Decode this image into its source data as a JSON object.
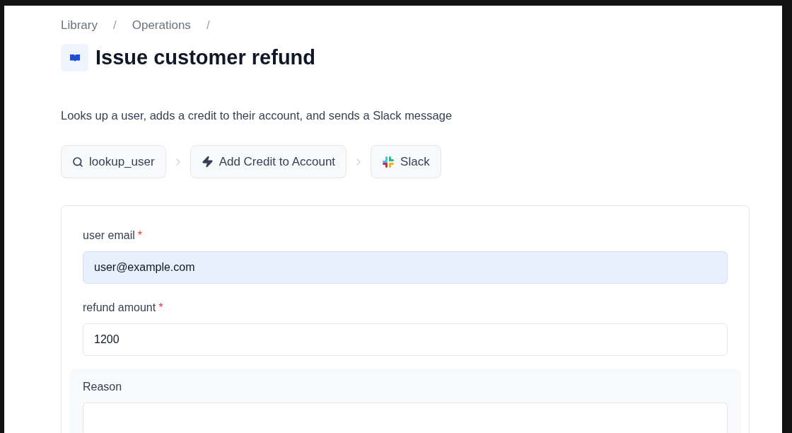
{
  "breadcrumbs": [
    {
      "label": "Library",
      "separator": "/"
    },
    {
      "label": "Operations",
      "separator": "/"
    }
  ],
  "title": "Issue customer refund",
  "description": "Looks up a user, adds a credit to their account, and sends a Slack message",
  "steps": [
    {
      "kind": "search",
      "label": "lookup_user"
    },
    {
      "kind": "action",
      "label": "Add Credit to Account"
    },
    {
      "kind": "slack",
      "label": "Slack"
    }
  ],
  "form": {
    "fields": [
      {
        "label": "user email",
        "required_mark": "*",
        "value": "user@example.com",
        "autofilled": true,
        "section": false
      },
      {
        "label": "refund amount",
        "required_mark": "*",
        "value": "1200",
        "autofilled": false,
        "section": false
      },
      {
        "label": "Reason",
        "autofilled": false,
        "section": true
      }
    ]
  }
}
